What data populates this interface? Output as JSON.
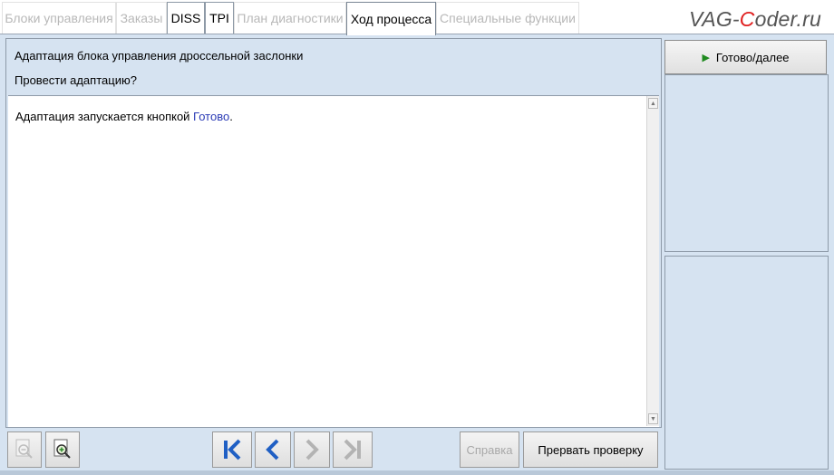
{
  "tabs": [
    {
      "label": "Блоки управления",
      "state": "disabled"
    },
    {
      "label": "Заказы",
      "state": "disabled"
    },
    {
      "label": "DISS",
      "state": "enabled"
    },
    {
      "label": "TPI",
      "state": "enabled"
    },
    {
      "label": "План диагностики",
      "state": "disabled"
    },
    {
      "label": "Ход процесса",
      "state": "active"
    },
    {
      "label": "Специальные функции",
      "state": "disabled"
    }
  ],
  "watermark": {
    "part1": "VAG-",
    "part2": "C",
    "part3": "oder.ru"
  },
  "main": {
    "title": "Адаптация блока управления дроссельной заслонки",
    "question": "Провести адаптацию?",
    "body_text": "Адаптация запускается кнопкой ",
    "body_link": "Готово",
    "body_end": "."
  },
  "side": {
    "next_label": "Готово/далее"
  },
  "toolbar": {
    "help_label": "Справка",
    "abort_label": "Прервать проверку"
  },
  "icons": {
    "zoom_out": "zoom-out-icon",
    "zoom_in": "zoom-in-icon",
    "first": "first-page-icon",
    "back": "back-arrow-icon",
    "forward": "forward-arrow-icon",
    "last": "last-page-icon"
  }
}
